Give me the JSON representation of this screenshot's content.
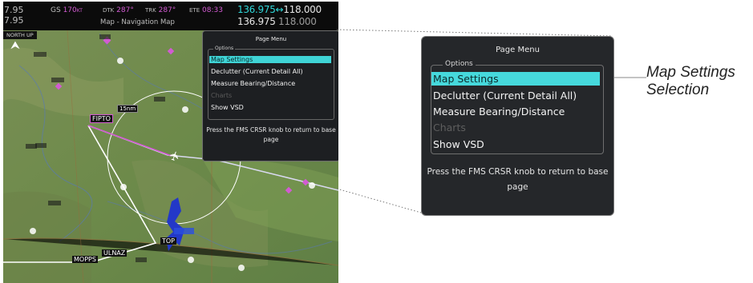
{
  "topbar": {
    "ghost_top": "7.95",
    "ghost_bottom": "7.95",
    "gs_label": "GS",
    "gs_value": "170",
    "gs_unit": "KT",
    "dtk_label": "DTK",
    "dtk_value": "287°",
    "trk_label": "TRK",
    "trk_value": "287°",
    "ete_label": "ETE",
    "ete_value": "08:33",
    "page_title": "Map - Navigation Map",
    "freq_active": "136.975",
    "freq_arrow": "↔",
    "freq_standby": "118.000",
    "freq_active_2": "136.975",
    "freq_standby_2": "118.000"
  },
  "map": {
    "orientation": "NORTH UP",
    "range_label": "15nm",
    "waypoints": [
      "FIPTO",
      "ULNAZ",
      "MOPPS",
      "TOP"
    ]
  },
  "menu": {
    "title": "Page Menu",
    "group_label": "Options",
    "items": [
      {
        "label": "Map Settings",
        "state": "selected"
      },
      {
        "label": "Declutter (Current Detail All)",
        "state": "normal"
      },
      {
        "label": "Measure Bearing/Distance",
        "state": "normal"
      },
      {
        "label": "Charts",
        "state": "disabled"
      },
      {
        "label": "Show VSD",
        "state": "normal"
      }
    ],
    "footer": "Press the FMS CRSR knob to return to base page"
  },
  "callout": {
    "line1": "Map Settings",
    "line2": "Selection"
  },
  "colors": {
    "selection_cyan": "#46d9dc",
    "magenta": "#d25bd2",
    "menu_bg": "#25272a",
    "route_line": "#ffffff",
    "lake_blue": "#2338c8"
  }
}
